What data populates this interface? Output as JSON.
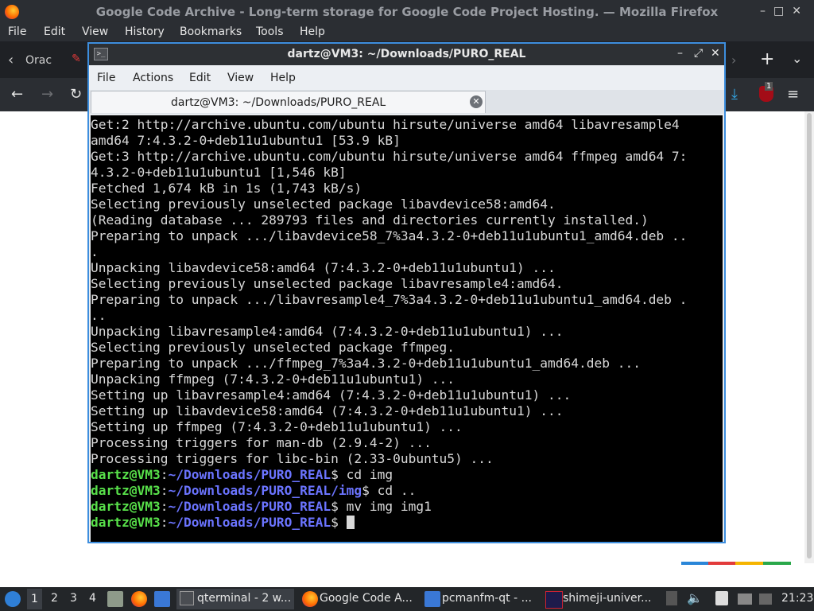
{
  "firefox": {
    "window_title": "Google Code Archive - Long-term storage for Google Code Project Hosting. — Mozilla Firefox",
    "menu": [
      "File",
      "Edit",
      "View",
      "History",
      "Bookmarks",
      "Tools",
      "Help"
    ],
    "tab_partial": "Orac",
    "badge_count": "1"
  },
  "terminal": {
    "window_title": "dartz@VM3: ~/Downloads/PURO_REAL",
    "menu": [
      "File",
      "Actions",
      "Edit",
      "View",
      "Help"
    ],
    "tab_label": "dartz@VM3: ~/Downloads/PURO_REAL",
    "output_lines": [
      "Get:2 http://archive.ubuntu.com/ubuntu hirsute/universe amd64 libavresample4",
      "amd64 7:4.3.2-0+deb11u1ubuntu1 [53.9 kB]",
      "Get:3 http://archive.ubuntu.com/ubuntu hirsute/universe amd64 ffmpeg amd64 7:",
      "4.3.2-0+deb11u1ubuntu1 [1,546 kB]",
      "Fetched 1,674 kB in 1s (1,743 kB/s)",
      "Selecting previously unselected package libavdevice58:amd64.",
      "(Reading database ... 289793 files and directories currently installed.)",
      "Preparing to unpack .../libavdevice58_7%3a4.3.2-0+deb11u1ubuntu1_amd64.deb ..",
      ".",
      "Unpacking libavdevice58:amd64 (7:4.3.2-0+deb11u1ubuntu1) ...",
      "Selecting previously unselected package libavresample4:amd64.",
      "Preparing to unpack .../libavresample4_7%3a4.3.2-0+deb11u1ubuntu1_amd64.deb .",
      "..",
      "Unpacking libavresample4:amd64 (7:4.3.2-0+deb11u1ubuntu1) ...",
      "Selecting previously unselected package ffmpeg.",
      "Preparing to unpack .../ffmpeg_7%3a4.3.2-0+deb11u1ubuntu1_amd64.deb ...",
      "Unpacking ffmpeg (7:4.3.2-0+deb11u1ubuntu1) ...",
      "Setting up libavresample4:amd64 (7:4.3.2-0+deb11u1ubuntu1) ...",
      "Setting up libavdevice58:amd64 (7:4.3.2-0+deb11u1ubuntu1) ...",
      "Setting up ffmpeg (7:4.3.2-0+deb11u1ubuntu1) ...",
      "Processing triggers for man-db (2.9.4-2) ...",
      "Processing triggers for libc-bin (2.33-0ubuntu5) ..."
    ],
    "prompts": [
      {
        "user": "dartz@VM3",
        "sep": ":",
        "path": "~/Downloads/PURO_REAL",
        "end": "$ ",
        "cmd": "cd img"
      },
      {
        "user": "dartz@VM3",
        "sep": ":",
        "path": "~/Downloads/PURO_REAL/img",
        "end": "$ ",
        "cmd": "cd .."
      },
      {
        "user": "dartz@VM3",
        "sep": ":",
        "path": "~/Downloads/PURO_REAL",
        "end": "$ ",
        "cmd": "mv img img1"
      },
      {
        "user": "dartz@VM3",
        "sep": ":",
        "path": "~/Downloads/PURO_REAL",
        "end": "$ ",
        "cmd": ""
      }
    ],
    "colors": {
      "user": "#58e04a",
      "path": "#6b74ff",
      "text": "#d8d8d8",
      "background": "#000000"
    }
  },
  "taskbar": {
    "workspaces": [
      "1",
      "2",
      "3",
      "4"
    ],
    "tasks": [
      {
        "icon": "terminal-icon",
        "label": "qterminal - 2 w..."
      },
      {
        "icon": "firefox-icon",
        "label": "Google Code A..."
      },
      {
        "icon": "folder-icon",
        "label": "pcmanfm-qt - ..."
      },
      {
        "icon": "app-icon",
        "label": "shimeji-univer..."
      }
    ],
    "clock": "21:23"
  }
}
